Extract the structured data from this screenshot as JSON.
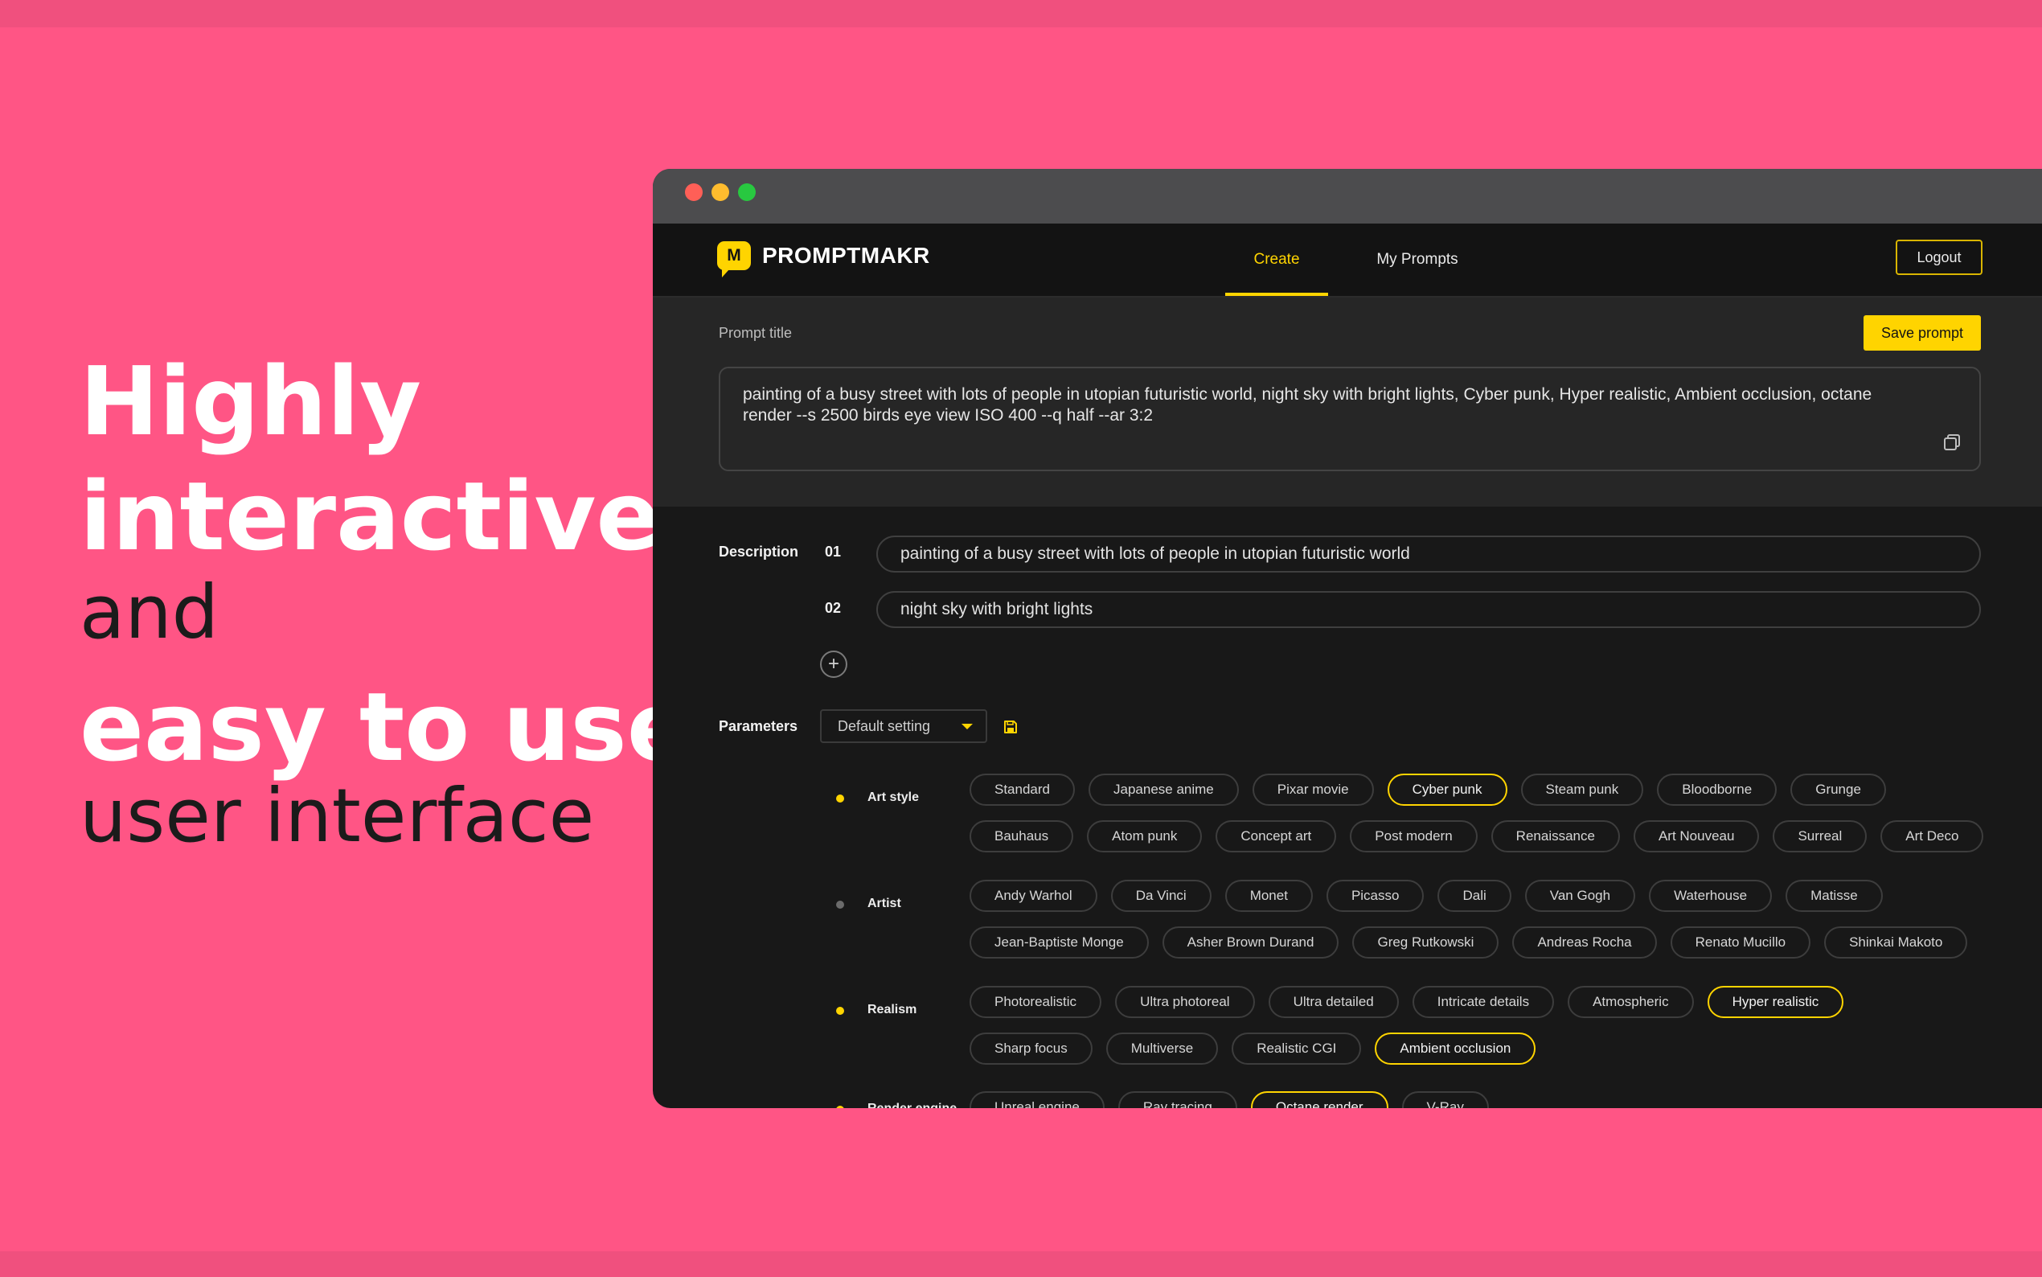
{
  "colors": {
    "background": "#ff5585",
    "accent": "#ffd400",
    "app_bg": "#181818",
    "title_area_bg": "#262626"
  },
  "headline": {
    "line1": "Highly",
    "line2": "interactive",
    "line3": "and",
    "line4": "easy to use",
    "line5": "user interface"
  },
  "app": {
    "logo_letter": "M",
    "logo_text": "PROMPTMAKR",
    "tabs": [
      {
        "label": "Create",
        "active": true
      },
      {
        "label": "My Prompts",
        "active": false
      }
    ],
    "logout_label": "Logout",
    "prompt_title_label": "Prompt title",
    "save_prompt_label": "Save prompt",
    "prompt_text": "painting of a busy street with lots of people in utopian futuristic world, night sky with bright lights, Cyber punk, Hyper realistic, Ambient occlusion, octane render --s 2500 birds eye view ISO 400 --q half --ar 3:2",
    "description": {
      "label": "Description",
      "items": [
        {
          "num": "01",
          "text": "painting of a busy street with lots of people in utopian futuristic world"
        },
        {
          "num": "02",
          "text": "night sky with bright lights"
        }
      ],
      "add_symbol": "+"
    },
    "parameters": {
      "label": "Parameters",
      "select_value": "Default setting",
      "icons": [
        "chevron-down-icon",
        "save-icon",
        "copy-icon",
        "plus-icon"
      ]
    },
    "categories": [
      {
        "label": "Art style",
        "dot": "#ffd400",
        "rows": [
          [
            {
              "label": "Standard"
            },
            {
              "label": "Japanese anime"
            },
            {
              "label": "Pixar movie"
            },
            {
              "label": "Cyber punk",
              "selected": true
            },
            {
              "label": "Steam punk"
            },
            {
              "label": "Bloodborne"
            },
            {
              "label": "Grunge"
            }
          ],
          [
            {
              "label": "Bauhaus"
            },
            {
              "label": "Atom punk"
            },
            {
              "label": "Concept art"
            },
            {
              "label": "Post modern"
            },
            {
              "label": "Renaissance"
            },
            {
              "label": "Art Nouveau"
            },
            {
              "label": "Surreal"
            },
            {
              "label": "Art Deco"
            }
          ]
        ]
      },
      {
        "label": "Artist",
        "dot": "#6b6b6b",
        "rows": [
          [
            {
              "label": "Andy Warhol"
            },
            {
              "label": "Da Vinci"
            },
            {
              "label": "Monet"
            },
            {
              "label": "Picasso"
            },
            {
              "label": "Dali"
            },
            {
              "label": "Van Gogh"
            },
            {
              "label": "Waterhouse"
            },
            {
              "label": "Matisse"
            }
          ],
          [
            {
              "label": "Jean-Baptiste Monge"
            },
            {
              "label": "Asher Brown Durand"
            },
            {
              "label": "Greg Rutkowski"
            },
            {
              "label": "Andreas Rocha"
            },
            {
              "label": "Renato Mucillo"
            },
            {
              "label": "Shinkai Makoto"
            }
          ]
        ]
      },
      {
        "label": "Realism",
        "dot": "#ffd400",
        "rows": [
          [
            {
              "label": "Photorealistic"
            },
            {
              "label": "Ultra photoreal"
            },
            {
              "label": "Ultra detailed"
            },
            {
              "label": "Intricate details"
            },
            {
              "label": "Atmospheric"
            },
            {
              "label": "Hyper realistic",
              "selected": true
            }
          ],
          [
            {
              "label": "Sharp focus"
            },
            {
              "label": "Multiverse"
            },
            {
              "label": "Realistic CGI"
            },
            {
              "label": "Ambient occlusion",
              "selected": true
            }
          ]
        ]
      },
      {
        "label": "Render engine",
        "dot": "#ffd400",
        "rows": [
          [
            {
              "label": "Unreal engine"
            },
            {
              "label": "Ray tracing"
            },
            {
              "label": "Octane render",
              "selected": true
            },
            {
              "label": "V-Ray"
            }
          ]
        ]
      }
    ]
  }
}
